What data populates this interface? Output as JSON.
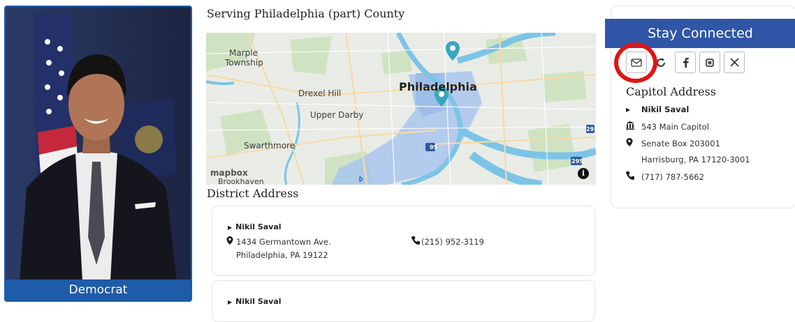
{
  "profile": {
    "party": "Democrat"
  },
  "district": {
    "serving_title": "Serving Philadelphia (part) County",
    "map": {
      "labels": {
        "marple": "Marple",
        "marple_twp": "Township",
        "drexel_hill": "Drexel Hill",
        "upper_darby": "Upper Darby",
        "swarthmore": "Swarthmore",
        "brookhaven": "Brookhaven",
        "philadelphia": "Philadelphia"
      },
      "attribution": "mapbox",
      "info_glyph": "i",
      "shields": [
        "95",
        "295",
        "29"
      ]
    },
    "address_title": "District Address",
    "offices": [
      {
        "name": "Nikil Saval",
        "address_line1": "1434 Germantown Ave.",
        "address_line2": "Philadelphia, PA 19122",
        "phone": "(215) 952-3119"
      },
      {
        "name": "Nikil Saval"
      }
    ]
  },
  "contact": {
    "banner": "Stay Connected",
    "social_icons": [
      "email-icon",
      "refresh-icon",
      "facebook-icon",
      "instagram-icon",
      "x-icon"
    ],
    "capitol_title": "Capitol Address",
    "name": "Nikil Saval",
    "room": "543 Main Capitol",
    "box": "Senate Box 203001",
    "city": "Harrisburg, PA 17120-3001",
    "phone": "(717) 787-5662",
    "highlight_color": "#e11414",
    "banner_color": "#2f56a7"
  }
}
